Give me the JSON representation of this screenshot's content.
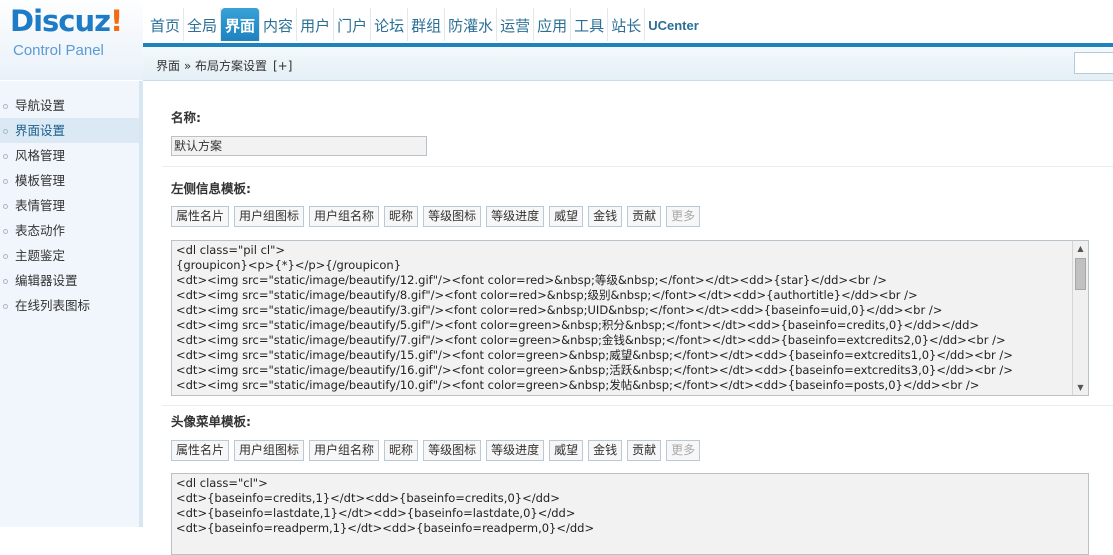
{
  "logo": {
    "brand": "Discuz",
    "bang": "!",
    "sub": "Control Panel"
  },
  "topnav": [
    {
      "label": "首页"
    },
    {
      "label": "全局"
    },
    {
      "label": "界面",
      "active": true
    },
    {
      "label": "内容"
    },
    {
      "label": "用户"
    },
    {
      "label": "门户"
    },
    {
      "label": "论坛"
    },
    {
      "label": "群组"
    },
    {
      "label": "防灌水"
    },
    {
      "label": "运营"
    },
    {
      "label": "应用"
    },
    {
      "label": "工具"
    },
    {
      "label": "站长"
    },
    {
      "label": "UCenter"
    }
  ],
  "breadcrumb": {
    "text": "界面 » 布局方案设置",
    "add": "[+]"
  },
  "sidebar": [
    {
      "label": "导航设置"
    },
    {
      "label": "界面设置",
      "active": true
    },
    {
      "label": "风格管理"
    },
    {
      "label": "模板管理"
    },
    {
      "label": "表情管理"
    },
    {
      "label": "表态动作"
    },
    {
      "label": "主题鉴定"
    },
    {
      "label": "编辑器设置"
    },
    {
      "label": "在线列表图标"
    }
  ],
  "form": {
    "name_label": "名称:",
    "name_value": "默认方案",
    "left_label": "左侧信息模板:",
    "avatar_label": "头像菜单模板:",
    "buttons": [
      "属性名片",
      "用户组图标",
      "用户组名称",
      "昵称",
      "等级图标",
      "等级进度",
      "威望",
      "金钱",
      "贡献",
      "更多"
    ],
    "left_code": [
      "<dl class=\"pil cl\">",
      "{groupicon}<p>{*}</p>{/groupicon}",
      "<dt><img src=\"static/image/beautify/12.gif\"/><font color=red>&nbsp;等级&nbsp;</font></dt><dd>{star}</dd><br />",
      "<dt><img src=\"static/image/beautify/8.gif\"/><font color=red>&nbsp;级别&nbsp;</font></dt><dd>{authortitle}</dd><br />",
      "<dt><img src=\"static/image/beautify/3.gif\"/><font color=red>&nbsp;UID&nbsp;</font></dt><dd>{baseinfo=uid,0}</dd><br />",
      "<dt><img src=\"static/image/beautify/5.gif\"/><font color=green>&nbsp;积分&nbsp;</font></dt><dd>{baseinfo=credits,0}</dd></dd>",
      "<dt><img src=\"static/image/beautify/7.gif\"/><font color=green>&nbsp;金钱&nbsp;</font></dt><dd>{baseinfo=extcredits2,0}</dd><br />",
      "<dt><img src=\"static/image/beautify/15.gif\"/><font color=green>&nbsp;威望&nbsp;</font></dt><dd>{baseinfo=extcredits1,0}</dd><br />",
      "<dt><img src=\"static/image/beautify/16.gif\"/><font color=green>&nbsp;活跃&nbsp;</font></dt><dd>{baseinfo=extcredits3,0}</dd><br />",
      "<dt><img src=\"static/image/beautify/10.gif\"/><font color=green>&nbsp;发帖&nbsp;</font></dt><dd>{baseinfo=posts,0}</dd><br />"
    ],
    "avatar_code": [
      "<dl class=\"cl\">",
      "<dt>{baseinfo=credits,1}</dt><dd>{baseinfo=credits,0}</dd>",
      "<dt>{baseinfo=lastdate,1}</dt><dd>{baseinfo=lastdate,0}</dd>",
      "<dt>{baseinfo=readperm,1}</dt><dd>{baseinfo=readperm,0}</dd>"
    ]
  }
}
